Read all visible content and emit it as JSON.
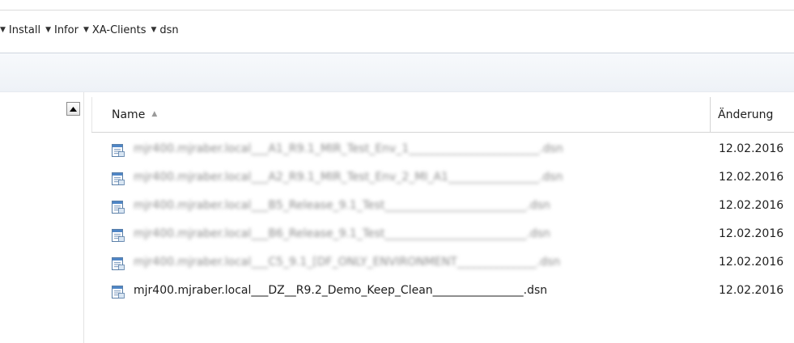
{
  "breadcrumb": {
    "items": [
      {
        "label": "Install"
      },
      {
        "label": "Infor"
      },
      {
        "label": "XA-Clients"
      },
      {
        "label": "dsn"
      }
    ]
  },
  "columns": {
    "name": {
      "label": "Name",
      "sort_indicator": "sort-ascending-icon"
    },
    "date": {
      "label": "Änderung"
    }
  },
  "files": [
    {
      "name": "mjr400.mjraber.local___A1_R9.1_MIR_Test_Env_1_______________________.dsn",
      "date": "12.02.2016",
      "blurred": true
    },
    {
      "name": "mjr400.mjraber.local___A2_R9.1_MIR_Test_Env_2_MI_A1________________.dsn",
      "date": "12.02.2016",
      "blurred": true
    },
    {
      "name": "mjr400.mjraber.local___B5_Release_9.1_Test_________________________.dsn",
      "date": "12.02.2016",
      "blurred": true
    },
    {
      "name": "mjr400.mjraber.local___B6_Release_9.1_Test_________________________.dsn",
      "date": "12.02.2016",
      "blurred": true
    },
    {
      "name": "mjr400.mjraber.local___C5_9.1_[DF_ONLY_ENVIRONMENT______________.dsn",
      "date": "12.02.2016",
      "blurred": true
    },
    {
      "name": "mjr400.mjraber.local___DZ__R9.2_Demo_Keep_Clean________________.dsn",
      "date": "12.02.2016",
      "blurred": false
    }
  ],
  "icons": {
    "file": "dsn-file-icon",
    "breadcrumb_arrow": "chevron-down-icon",
    "scroll_up": "scroll-up-arrow-icon"
  }
}
